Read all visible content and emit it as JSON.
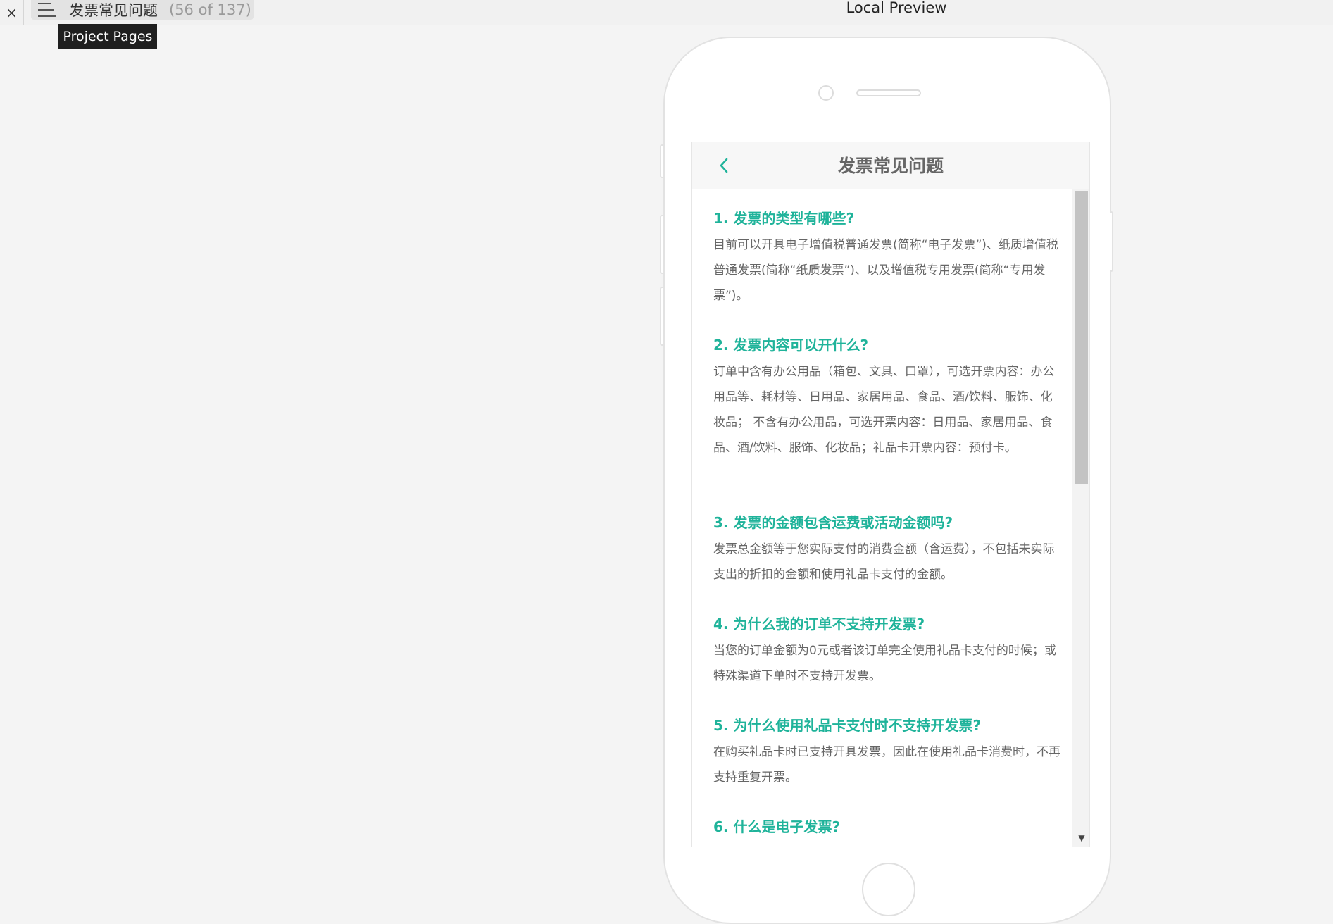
{
  "window": {
    "close_glyph": "×",
    "title": "Local Preview"
  },
  "pages_menu": {
    "page_name": "发票常见问题",
    "page_count": "(56 of 137)",
    "tooltip": "Project Pages"
  },
  "screen": {
    "back_glyph": "‹",
    "nav_title": "发票常见问题",
    "faq": [
      {
        "question": "1. 发票的类型有哪些?",
        "answer": "目前可以开具电子增值税普通发票(简称“电子发票”)、纸质增值税普通发票(简称“纸质发票”)、以及增值税专用发票(简称“专用发票”)。"
      },
      {
        "question": "2. 发票内容可以开什么?",
        "answer": "订单中含有办公用品（箱包、文具、口罩），可选开票内容：办公用品等、耗材等、日用品、家居用品、食品、酒/饮料、服饰、化妆品；  不含有办公用品，可选开票内容：日用品、家居用品、食品、酒/饮料、服饰、化妆品；礼品卡开票内容：预付卡。"
      },
      {
        "question": "3. 发票的金额包含运费或活动金额吗?",
        "answer": "发票总金额等于您实际支付的消费金额（含运费），不包括未实际支出的折扣的金额和使用礼品卡支付的金额。"
      },
      {
        "question": "4. 为什么我的订单不支持开发票?",
        "answer": "当您的订单金额为0元或者该订单完全使用礼品卡支付的时候；或特殊渠道下单时不支持开发票。"
      },
      {
        "question": "5. 为什么使用礼品卡支付时不支持开发票?",
        "answer": "在购买礼品卡时已支持开具发票，因此在使用礼品卡消费时，不再支持重复开票。"
      },
      {
        "question": "6. 什么是电子发票?",
        "answer": ""
      }
    ],
    "scroll_down_glyph": "▼"
  },
  "colors": {
    "accent": "#1fb39a",
    "answer_text": "#666666",
    "nav_title": "#666666"
  }
}
